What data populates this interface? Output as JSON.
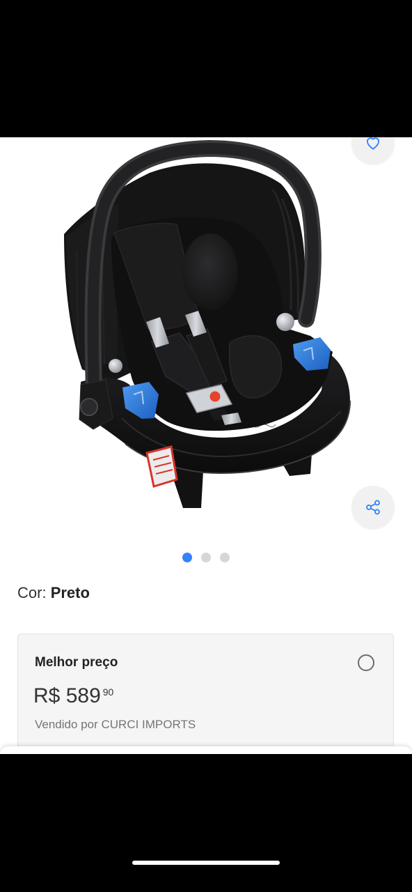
{
  "product": {
    "favorite_icon": "heart-icon",
    "share_icon": "share-icon",
    "carousel": {
      "slide_count": 3,
      "active_slide": 1
    }
  },
  "variant": {
    "label": "Cor:",
    "value": "Preto"
  },
  "offer": {
    "title": "Melhor preço",
    "currency": "R$",
    "price_whole": "589",
    "price_cents": "90",
    "seller_label": "Vendido por",
    "seller_name": "CURCI IMPORTS",
    "selected": false
  },
  "colors": {
    "accent": "#3483fa",
    "dot_inactive": "#d6d6d6",
    "card_bg": "#f5f5f5",
    "card_border": "#e2e2e2",
    "text_primary": "#333333",
    "text_muted": "#757575",
    "letterbox": "#000000",
    "button_bg": "#f1f1f1"
  }
}
